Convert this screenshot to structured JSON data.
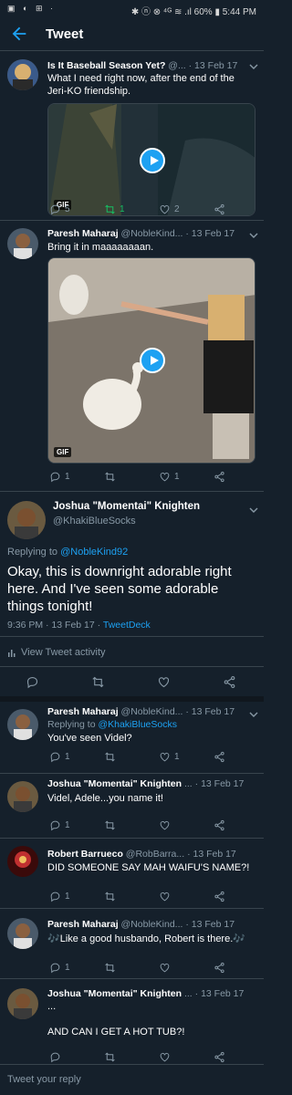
{
  "status": {
    "left_icons": "▣ ◐ ⊞ ·",
    "right": "✱ ⓝ ⊗ ⁴ᴳ ≋ .ıl 60% ▮ 5:44 PM"
  },
  "header": {
    "title": "Tweet"
  },
  "tweets": [
    {
      "name": "Is It Baseball Season Yet?",
      "handle": "@...",
      "date": "· 13 Feb 17",
      "text": "What I need right now, after the end of the Jeri-KO friendship.",
      "media_label": "GIF",
      "replies": "5",
      "retweets": "1",
      "likes": "2",
      "avatar_color": "#5a4a2a"
    },
    {
      "name": "Paresh Maharaj",
      "handle": "@NobleKind...",
      "date": "· 13 Feb 17",
      "text": "Bring it in maaaaaaaan.",
      "media_label": "GIF",
      "replies": "1",
      "retweets": "",
      "likes": "1",
      "avatar_color": "#6b5a4a"
    }
  ],
  "main_tweet": {
    "name": "Joshua \"Momentai\" Knighten",
    "handle": "@KhakiBlueSocks",
    "replying_prefix": "Replying to",
    "replying_to": "@NobleKind92",
    "text": "Okay, this is downright adorable right here. And I've seen some adorable things tonight!",
    "time": "9:36 PM · 13 Feb 17 ·",
    "source": "TweetDeck",
    "activity": "View Tweet activity"
  },
  "replies": [
    {
      "name": "Paresh Maharaj",
      "handle": "@NobleKind...",
      "date": "· 13 Feb 17",
      "replying_prefix": "Replying to",
      "replying_to": "@KhakiBlueSocks",
      "text": "You've seen Videl?",
      "replies": "1",
      "likes": "1"
    },
    {
      "name": "Joshua \"Momentai\" Knighten",
      "handle": "...",
      "date": "· 13 Feb 17",
      "text": "Videl, Adele...you name it!",
      "replies": "1",
      "likes": ""
    },
    {
      "name": "Robert Barrueco",
      "handle": "@RobBarra...",
      "date": "· 13 Feb 17",
      "text": "DID SOMEONE SAY MAH WAIFU'S NAME?!",
      "replies": "1",
      "likes": ""
    },
    {
      "name": "Paresh Maharaj",
      "handle": "@NobleKind...",
      "date": "· 13 Feb 17",
      "text": "🎶Like a good husbando, Robert is there.🎶",
      "replies": "1",
      "likes": ""
    },
    {
      "name": "Joshua \"Momentai\" Knighten",
      "handle": "...",
      "date": "· 13 Feb 17",
      "text": "...",
      "text2": "AND CAN I GET A HOT TUB?!",
      "replies": "",
      "likes": ""
    }
  ],
  "compose": {
    "placeholder": "Tweet your reply"
  },
  "colors": {
    "background": "#15202b",
    "accent": "#1da1f2",
    "muted": "#8899a6",
    "retweet_active": "#17bf63",
    "divider": "#38444d"
  },
  "icons": [
    "back-arrow-icon",
    "reply-icon",
    "retweet-icon",
    "like-icon",
    "share-icon",
    "play-icon",
    "activity-icon"
  ]
}
